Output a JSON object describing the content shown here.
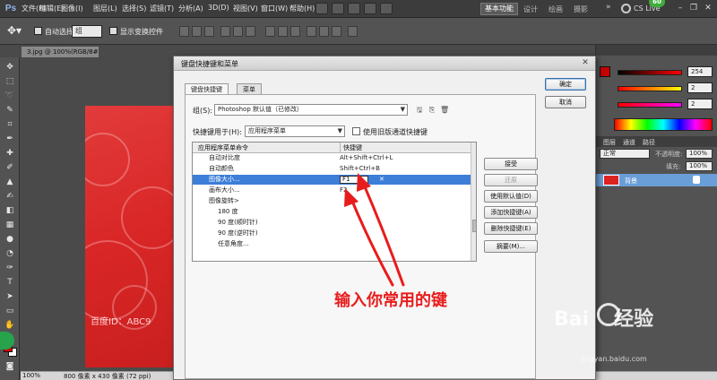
{
  "app": {
    "logo": "Ps",
    "menu": [
      "文件(F)",
      "编辑(E)",
      "图像(I)",
      "图层(L)",
      "选择(S)",
      "滤镜(T)",
      "分析(A)",
      "3D(D)",
      "视图(V)",
      "窗口(W)",
      "帮助(H)"
    ],
    "workspace": "基本功能",
    "workspace_links": [
      "设计",
      "绘画",
      "摄影"
    ],
    "more": "»",
    "cs_live": "CS Live",
    "badge": "60"
  },
  "options_bar": {
    "auto_select_label": "自动选择:",
    "auto_select_value": "组",
    "show_transform_label": "显示变换控件"
  },
  "document": {
    "tab_title": "3.jpg @ 100%(RGB/8#)",
    "watermark": "百度ID：ABC9",
    "zoom": "100%",
    "size": "800 像素 x 430 像素 (72 ppi)"
  },
  "panels": {
    "color_values": [
      "254",
      "2",
      "2"
    ],
    "tabs_layers": [
      "图层",
      "通道",
      "路径"
    ],
    "blend_mode": "正常",
    "opacity_label": "不透明度:",
    "opacity_value": "100%",
    "fill_label": "填充:",
    "fill_value": "100%",
    "layer_name": "背景"
  },
  "dialog": {
    "title": "键盘快捷键和菜单",
    "tabs": [
      "键盘快捷键",
      "菜单"
    ],
    "set_label": "组(S):",
    "set_value": "Photoshop 默认值（已修改）",
    "for_label": "快捷键用于(H):",
    "for_value": "应用程序菜单",
    "legacy_label": "使用旧版通道快捷键",
    "columns": [
      "应用程序菜单命令",
      "快捷键"
    ],
    "rows": [
      {
        "cmd": "自动对比度",
        "key": "Alt+Shift+Ctrl+L",
        "indent": 1
      },
      {
        "cmd": "自动颜色",
        "key": "Shift+Ctrl+B",
        "indent": 1
      },
      {
        "cmd": "图像大小...",
        "key": "F1",
        "indent": 1,
        "selected": true
      },
      {
        "cmd": "画布大小...",
        "key": "F2",
        "indent": 1
      },
      {
        "cmd": "图像旋转>",
        "key": "",
        "indent": 1
      },
      {
        "cmd": "180 度",
        "key": "",
        "indent": 2
      },
      {
        "cmd": "90 度(顺时针)",
        "key": "",
        "indent": 2
      },
      {
        "cmd": "90 度(逆时针)",
        "key": "",
        "indent": 2
      },
      {
        "cmd": "任意角度...",
        "key": "",
        "indent": 2
      }
    ],
    "side_buttons": [
      "接受",
      "还原",
      "使用默认值(D)",
      "添加快捷键(A)",
      "删除快捷键(E)",
      "摘要(M)..."
    ],
    "ok": "确定",
    "cancel": "取消"
  },
  "annotation": {
    "text": "输入你常用的键",
    "color": "#e81c1c"
  },
  "watermark": {
    "brand": "Bai",
    "brand_tail": "经验",
    "site": "jingyan.baidu.com"
  }
}
